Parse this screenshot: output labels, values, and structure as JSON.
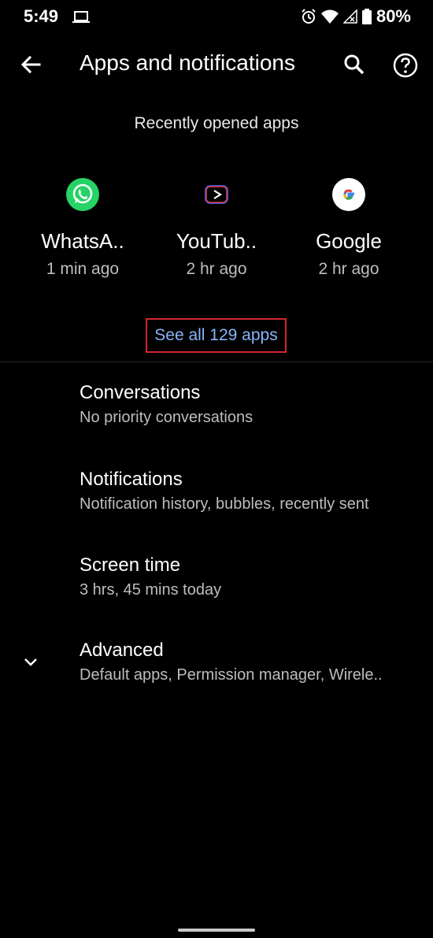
{
  "status": {
    "time": "5:49",
    "battery": "80%"
  },
  "app_bar": {
    "title": "Apps and notifications"
  },
  "recent": {
    "header": "Recently opened apps",
    "apps": [
      {
        "name": "WhatsA..",
        "time": "1 min ago"
      },
      {
        "name": "YouTub..",
        "time": "2 hr ago"
      },
      {
        "name": "Google",
        "time": "2 hr ago"
      }
    ],
    "see_all": "See all 129 apps"
  },
  "settings": [
    {
      "title": "Conversations",
      "subtitle": "No priority conversations"
    },
    {
      "title": "Notifications",
      "subtitle": "Notification history, bubbles, recently sent"
    },
    {
      "title": "Screen time",
      "subtitle": "3 hrs, 45 mins today"
    },
    {
      "title": "Advanced",
      "subtitle": "Default apps, Permission manager, Wirele.."
    }
  ],
  "colors": {
    "accent_link": "#8ab4f8",
    "highlight_box": "#d1242f",
    "whatsapp_green": "#25d366"
  }
}
